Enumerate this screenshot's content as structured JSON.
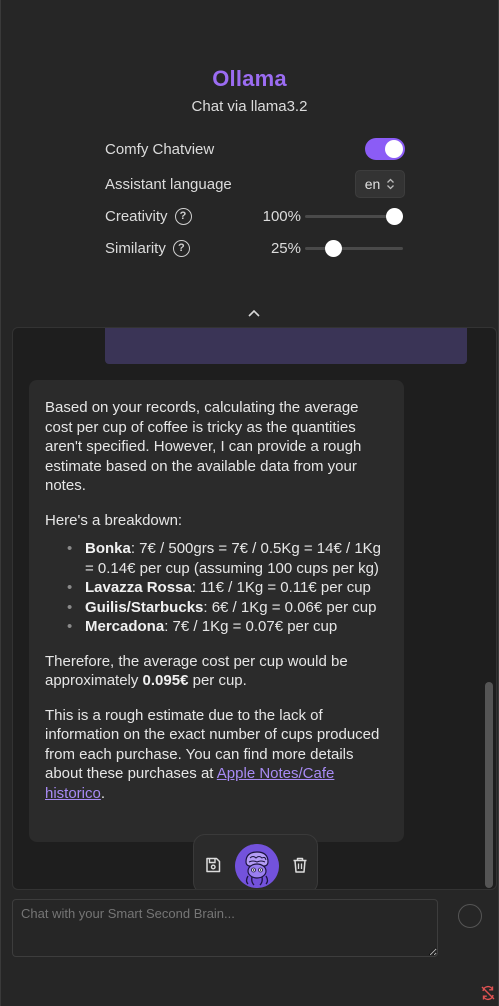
{
  "header": {
    "title": "Ollama",
    "subtitle": "Chat via llama3.2"
  },
  "settings": {
    "comfy_chatview": {
      "label": "Comfy Chatview",
      "enabled": true
    },
    "assistant_language": {
      "label": "Assistant language",
      "value": "en"
    },
    "creativity": {
      "label": "Creativity",
      "value_text": "100%",
      "value": 1.0
    },
    "similarity": {
      "label": "Similarity",
      "value_text": "25%",
      "value": 0.25
    }
  },
  "message": {
    "intro": "Based on your records, calculating the average cost per cup of coffee is tricky as the quantities aren't specified. However, I can provide a rough estimate based on the available data from your notes.",
    "breakdown_heading": "Here's a breakdown:",
    "items": [
      {
        "name": "Bonka",
        "detail": ": 7€ / 500grs = 7€ / 0.5Kg = 14€ / 1Kg = 0.14€ per cup (assuming 100 cups per kg)"
      },
      {
        "name": "Lavazza Rossa",
        "detail": ": 11€ / 1Kg = 0.11€ per cup"
      },
      {
        "name": "Guilis/Starbucks",
        "detail": ": 6€ / 1Kg = 0.06€ per cup"
      },
      {
        "name": "Mercadona",
        "detail": ": 7€ / 1Kg = 0.07€ per cup"
      }
    ],
    "conclusion_before": "Therefore, the average cost per cup would be approximately ",
    "conclusion_value": "0.095€",
    "conclusion_after": " per cup.",
    "note_text": "This is a rough estimate due to the lack of information on the exact number of cups produced from each purchase. You can find more details about these purchases at ",
    "note_link": "Apple Notes/Cafe historico",
    "note_end": "."
  },
  "input": {
    "placeholder": "Chat with your Smart Second Brain..."
  },
  "colors": {
    "accent": "#8b5cf6",
    "title": "#9b6cf2",
    "link": "#a88bf5"
  },
  "icons": [
    "help-icon",
    "chevron-up-icon",
    "save-icon",
    "avatar-icon",
    "trash-icon",
    "send-icon",
    "sync-off-icon"
  ]
}
